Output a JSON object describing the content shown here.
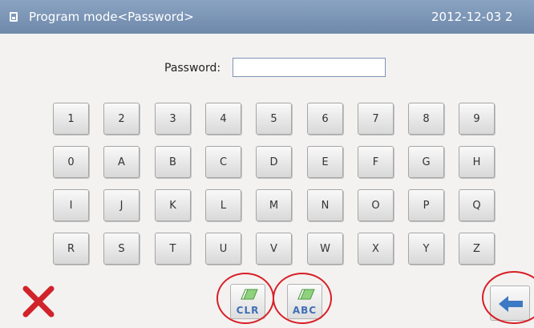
{
  "titlebar": {
    "title": "Program mode<Password>",
    "clock": "2012-12-03  2"
  },
  "password": {
    "label": "Password:",
    "value": "",
    "placeholder": ""
  },
  "keypad": {
    "rows": [
      [
        "1",
        "2",
        "3",
        "4",
        "5",
        "6",
        "7",
        "8",
        "9"
      ],
      [
        "0",
        "A",
        "B",
        "C",
        "D",
        "E",
        "F",
        "G",
        "H"
      ],
      [
        "I",
        "J",
        "K",
        "L",
        "M",
        "N",
        "O",
        "P",
        "Q"
      ],
      [
        "R",
        "S",
        "T",
        "U",
        "V",
        "W",
        "X",
        "Y",
        "Z"
      ]
    ]
  },
  "buttons": {
    "cancel_icon": "close-icon",
    "clear_label": "CLR",
    "abc_label": "ABC",
    "back_icon": "back-arrow-icon"
  },
  "colors": {
    "titlebar": "#7b93b4",
    "cancel": "#d1232a",
    "button_text": "#3f6fb6",
    "highlight_circle": "#d81f26"
  }
}
